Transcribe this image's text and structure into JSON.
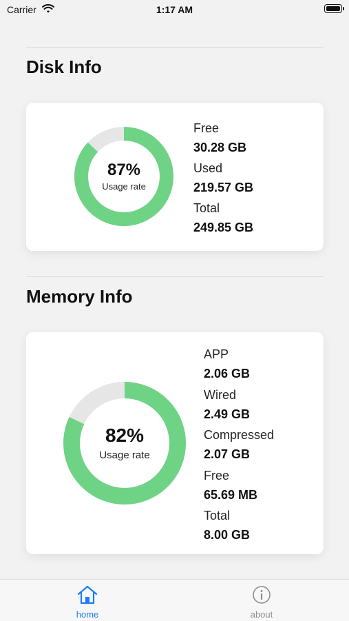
{
  "status_bar": {
    "carrier": "Carrier",
    "time": "1:17 AM"
  },
  "disk": {
    "title": "Disk Info",
    "usage_percent": 87,
    "usage_text": "87%",
    "usage_caption": "Usage rate",
    "stats": [
      {
        "label": "Free",
        "value": "30.28 GB"
      },
      {
        "label": "Used",
        "value": "219.57 GB"
      },
      {
        "label": "Total",
        "value": "249.85 GB"
      }
    ]
  },
  "memory": {
    "title": "Memory Info",
    "usage_percent": 82,
    "usage_text": "82%",
    "usage_caption": "Usage rate",
    "stats": [
      {
        "label": "APP",
        "value": "2.06 GB"
      },
      {
        "label": "Wired",
        "value": "2.49 GB"
      },
      {
        "label": "Compressed",
        "value": "2.07 GB"
      },
      {
        "label": "Free",
        "value": "65.69 MB"
      },
      {
        "label": "Total",
        "value": "8.00 GB"
      }
    ]
  },
  "tab_bar": {
    "home_label": "home",
    "about_label": "about"
  },
  "colors": {
    "ring_used": "#6fd386",
    "ring_free": "#e6e6e6",
    "tab_active": "#1e7cf2",
    "tab_inactive": "#8e8e93"
  }
}
